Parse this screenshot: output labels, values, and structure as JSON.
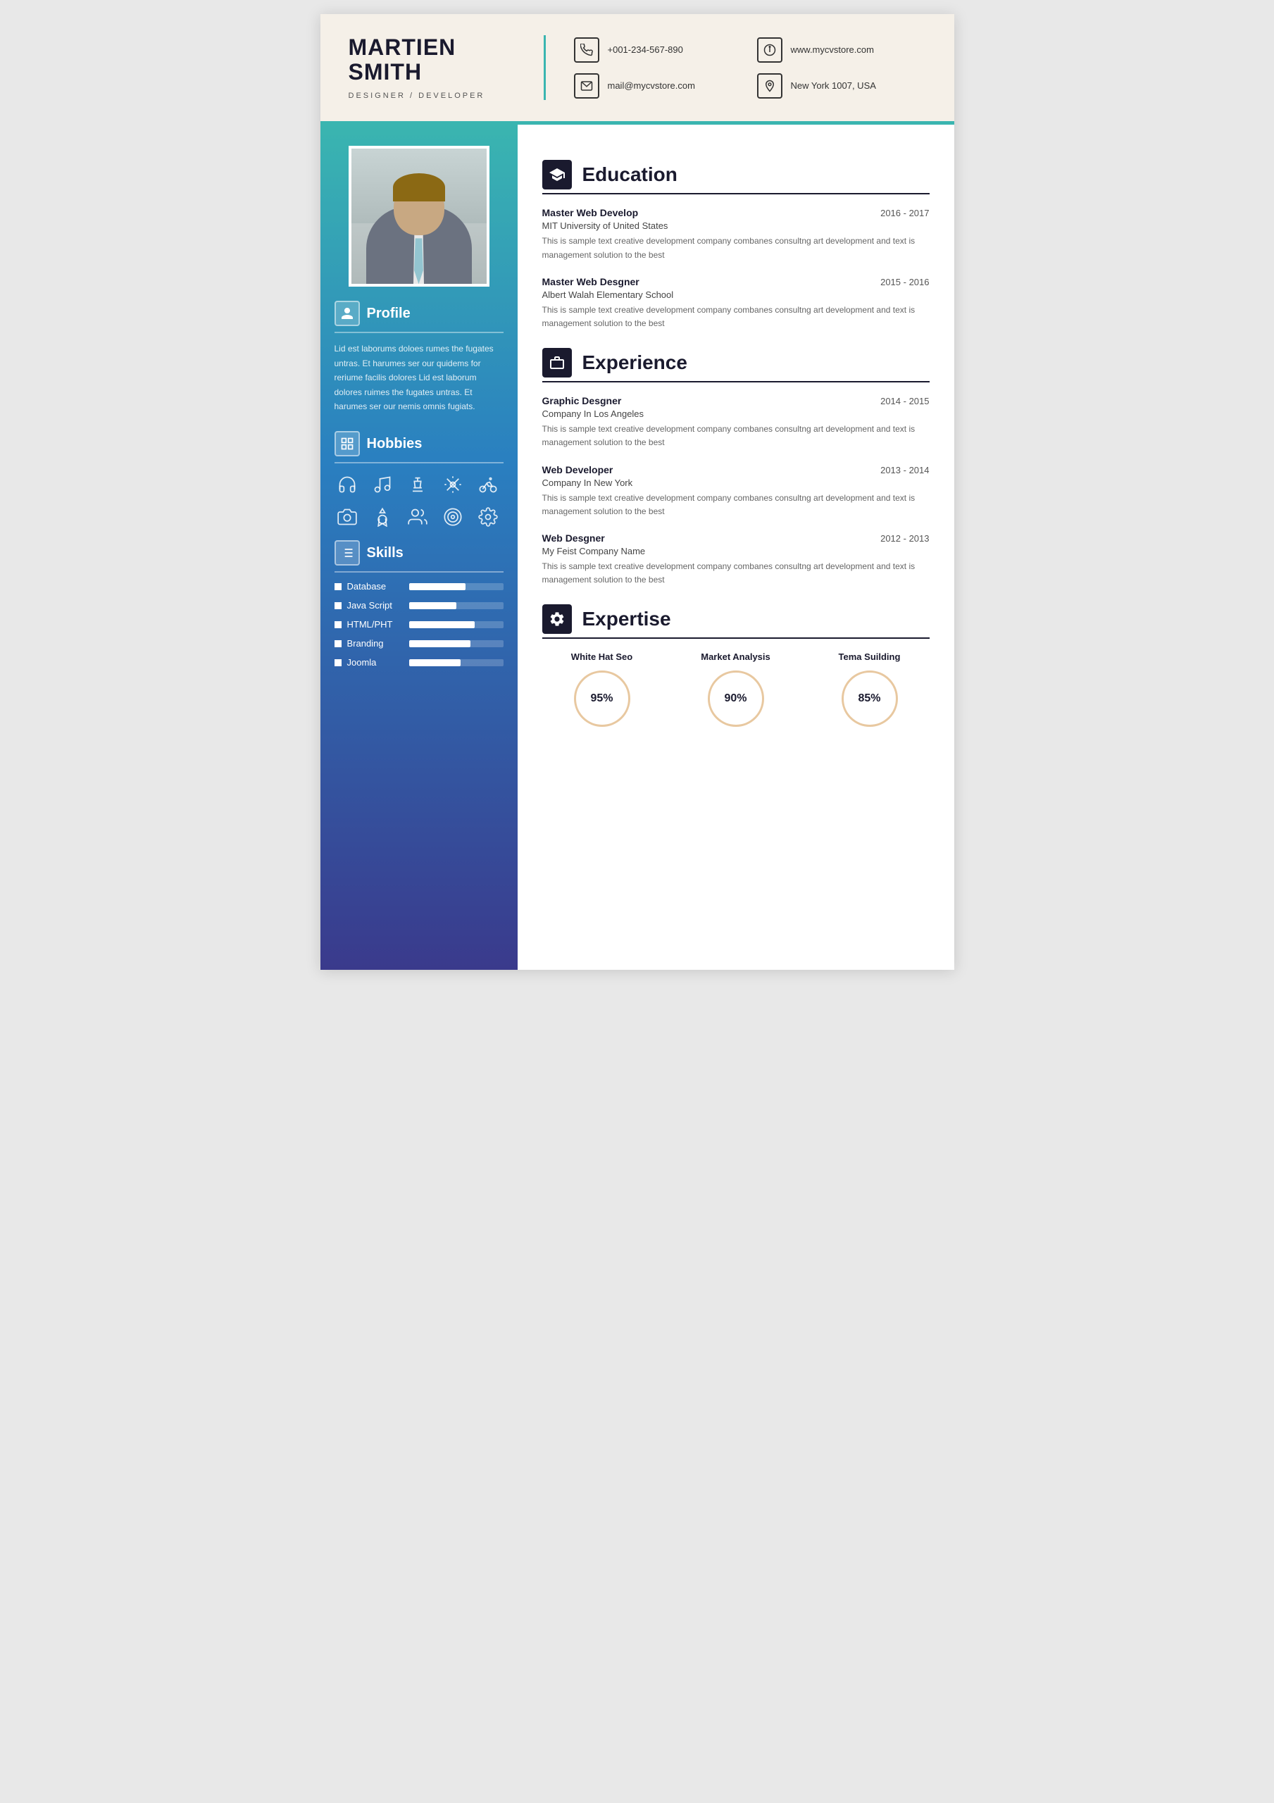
{
  "header": {
    "name_line1": "MARTIEN",
    "name_line2": "SMITH",
    "title": "DESIGNER / DEVELOPER",
    "contacts": [
      {
        "id": "phone",
        "icon": "📞",
        "text": "+001-234-567-890"
      },
      {
        "id": "website",
        "icon": "🖱",
        "text": "www.mycvstore.com"
      },
      {
        "id": "email",
        "icon": "✉",
        "text": "mail@mycvstore.com"
      },
      {
        "id": "location",
        "icon": "📍",
        "text": "New York 1007, USA"
      }
    ]
  },
  "sidebar": {
    "profile": {
      "section_title": "Profile",
      "text": "Lid est laborums doloes rumes the fugates untras. Et harumes ser our quidems for reriume facilis dolores Lid est laborum dolores ruimes the fugates untras. Et harumes ser our nemis omnis fugiats."
    },
    "hobbies": {
      "section_title": "Hobbies",
      "icons": [
        "🎧",
        "🎵",
        "♟",
        "📡",
        "🚴",
        "📷",
        "🏅",
        "👥",
        "🎯",
        "⚙"
      ]
    },
    "skills": {
      "section_title": "Skills",
      "items": [
        {
          "name": "Database",
          "percent": 60
        },
        {
          "name": "Java Script",
          "percent": 50
        },
        {
          "name": "HTML/PHT",
          "percent": 70
        },
        {
          "name": "Branding",
          "percent": 65
        },
        {
          "name": "Joomla",
          "percent": 55
        }
      ]
    }
  },
  "main": {
    "education": {
      "section_title": "Education",
      "entries": [
        {
          "title": "Master Web Develop",
          "date": "2016 - 2017",
          "subtitle": "MIT University of United States",
          "desc": "This is sample text creative development company combanes consultng art development and text is management solution to the best"
        },
        {
          "title": "Master Web Desgner",
          "date": "2015 - 2016",
          "subtitle": "Albert Walah Elementary School",
          "desc": "This is sample text creative development company combanes consultng art development and text is management solution to the best"
        }
      ]
    },
    "experience": {
      "section_title": "Experience",
      "entries": [
        {
          "title": "Graphic Desgner",
          "date": "2014 - 2015",
          "subtitle": "Company In Los Angeles",
          "desc": "This is sample text creative development company combanes consultng art development and text is management solution to the best"
        },
        {
          "title": "Web Developer",
          "date": "2013 - 2014",
          "subtitle": "Company In New York",
          "desc": "This is sample text creative development company combanes consultng art development and text is management solution to the best"
        },
        {
          "title": "Web Desgner",
          "date": "2012 - 2013",
          "subtitle": "My Feist Company Name",
          "desc": "This is sample text creative development company combanes consultng art development and text is management solution to the best"
        }
      ]
    },
    "expertise": {
      "section_title": "Expertise",
      "items": [
        {
          "label": "White Hat Seo",
          "percent": "95%"
        },
        {
          "label": "Market Analysis",
          "percent": "90%"
        },
        {
          "label": "Tema Suilding",
          "percent": "85%"
        }
      ]
    }
  }
}
